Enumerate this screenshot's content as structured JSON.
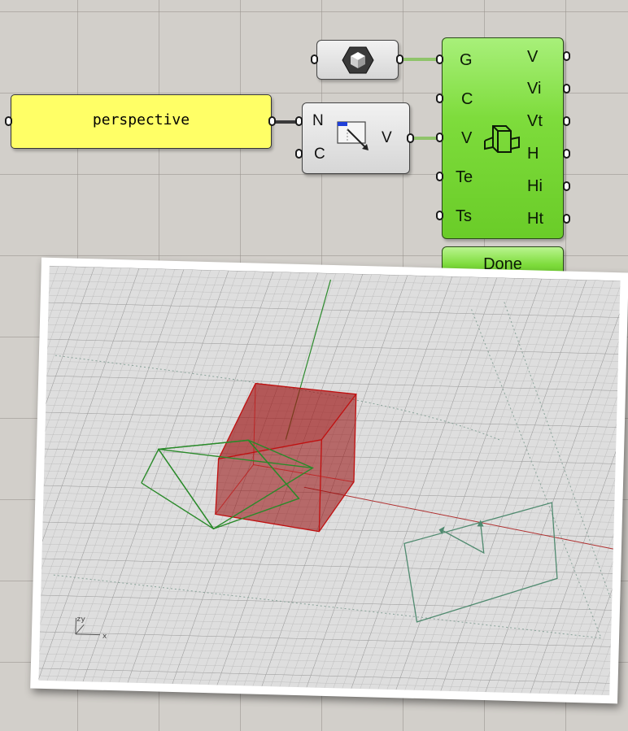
{
  "panel": {
    "text": "perspective"
  },
  "vector_component": {
    "inputs": [
      "N",
      "C"
    ],
    "output": "V"
  },
  "shaded_component": {
    "icon": "shaded-cube-icon"
  },
  "viewport_component": {
    "inputs": [
      "G",
      "C",
      "V",
      "Te",
      "Ts"
    ],
    "outputs": [
      "V",
      "Vi",
      "Vt",
      "H",
      "Hi",
      "Ht"
    ],
    "icon": "box-viewport-icon",
    "button_label": "Done"
  },
  "viewport": {
    "axis_labels": {
      "y": "y",
      "z": "z",
      "x": "x"
    },
    "colors": {
      "box": "#b01818",
      "frustum": "#2a8a2a",
      "x_axis": "#b03030",
      "y_axis": "#2e8b2e"
    }
  },
  "colors": {
    "canvas": "#d2cfca",
    "panel": "#ffff66",
    "component": "#7edc3c",
    "wire_green": "#8fc46a"
  }
}
